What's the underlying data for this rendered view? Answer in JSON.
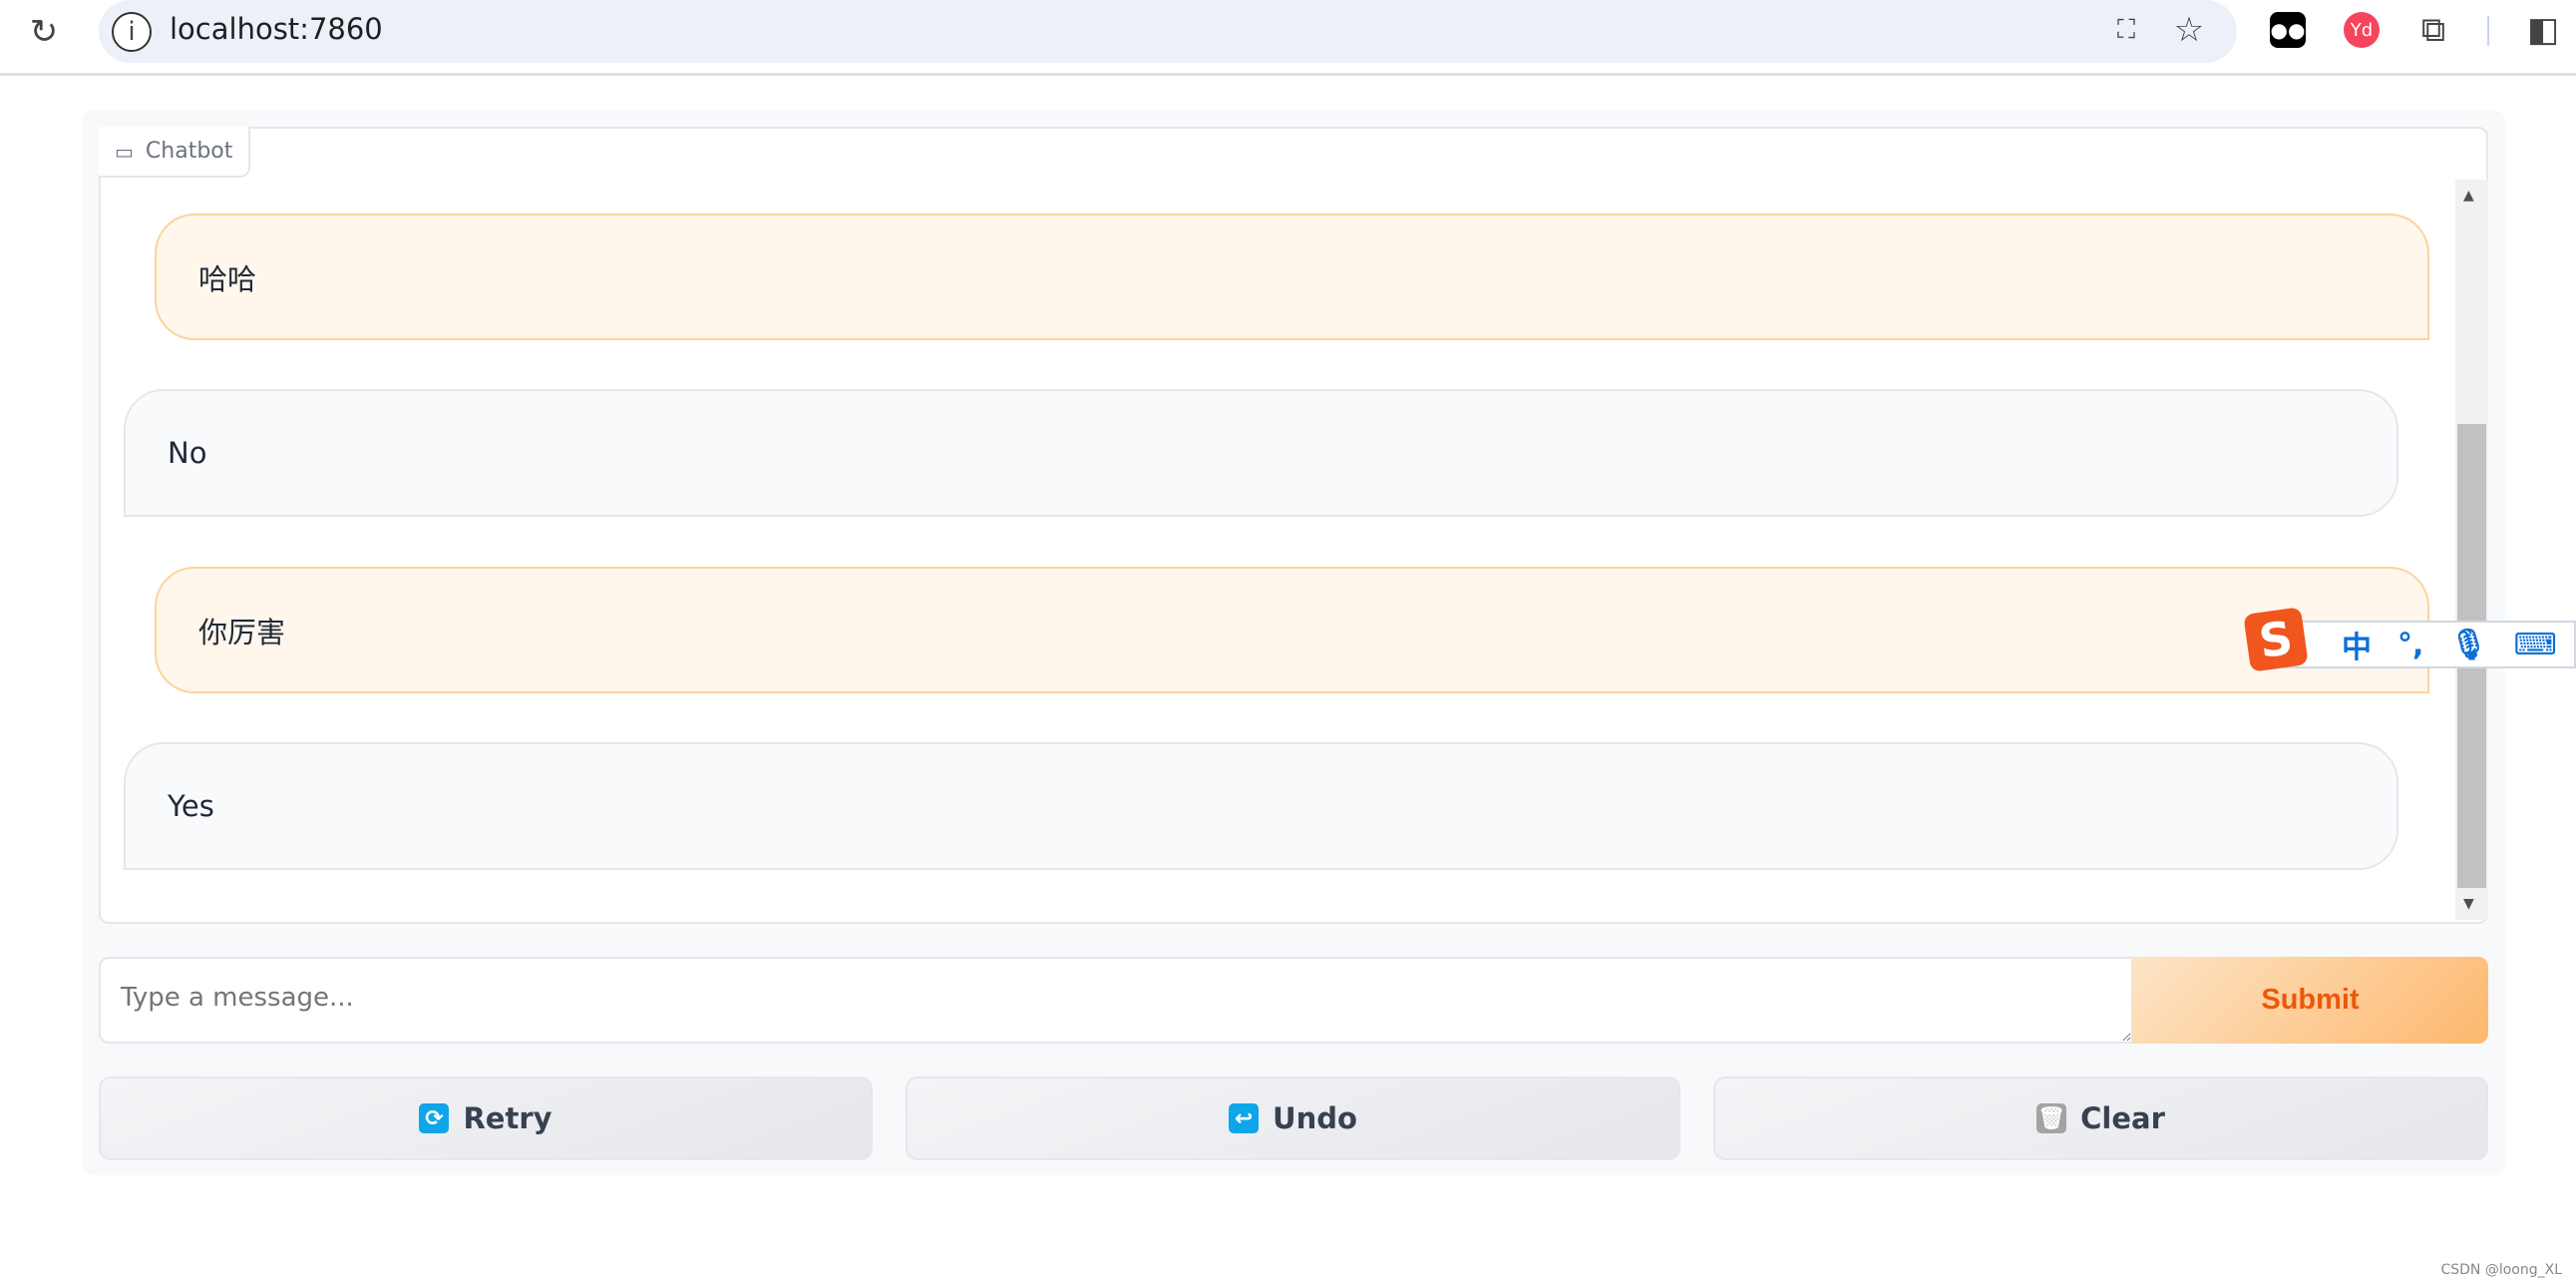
{
  "browser": {
    "url": "localhost:7860"
  },
  "chatbot": {
    "label": "Chatbot",
    "messages": [
      {
        "role": "user",
        "text": "哈哈"
      },
      {
        "role": "bot",
        "text": "No"
      },
      {
        "role": "user",
        "text": "你厉害"
      },
      {
        "role": "bot",
        "text": "Yes"
      }
    ]
  },
  "input": {
    "placeholder": "Type a message...",
    "value": ""
  },
  "submit_label": "Submit",
  "buttons": {
    "retry": "Retry",
    "undo": "Undo",
    "clear": "Clear"
  },
  "ime": {
    "mode": "中",
    "punct": "°,"
  },
  "watermark": "CSDN @loong_XL",
  "colors": {
    "accent": "#ea580c",
    "user_bubble": "#fff6ec",
    "icon_blue": "#0ea5e9"
  }
}
